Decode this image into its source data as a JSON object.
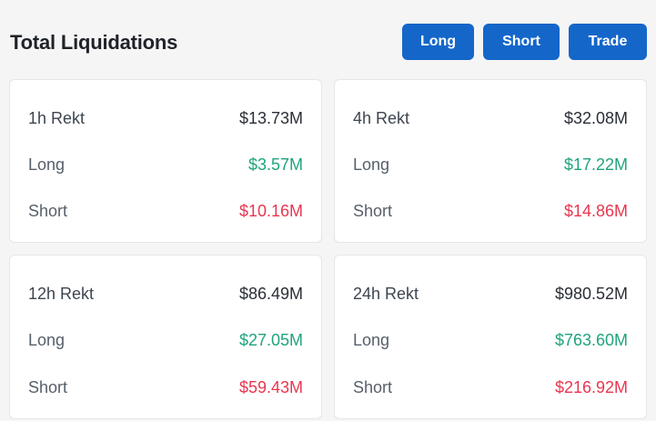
{
  "header": {
    "title": "Total Liquidations",
    "buttons": {
      "long": "Long",
      "short": "Short",
      "trade": "Trade"
    }
  },
  "colors": {
    "button_bg": "#1466c9",
    "long_value": "#1fa37e",
    "short_value": "#e8364f"
  },
  "cards": [
    {
      "label": "1h Rekt",
      "total": "$13.73M",
      "long_label": "Long",
      "long": "$3.57M",
      "short_label": "Short",
      "short": "$10.16M"
    },
    {
      "label": "4h Rekt",
      "total": "$32.08M",
      "long_label": "Long",
      "long": "$17.22M",
      "short_label": "Short",
      "short": "$14.86M"
    },
    {
      "label": "12h Rekt",
      "total": "$86.49M",
      "long_label": "Long",
      "long": "$27.05M",
      "short_label": "Short",
      "short": "$59.43M"
    },
    {
      "label": "24h Rekt",
      "total": "$980.52M",
      "long_label": "Long",
      "long": "$763.60M",
      "short_label": "Short",
      "short": "$216.92M"
    }
  ]
}
